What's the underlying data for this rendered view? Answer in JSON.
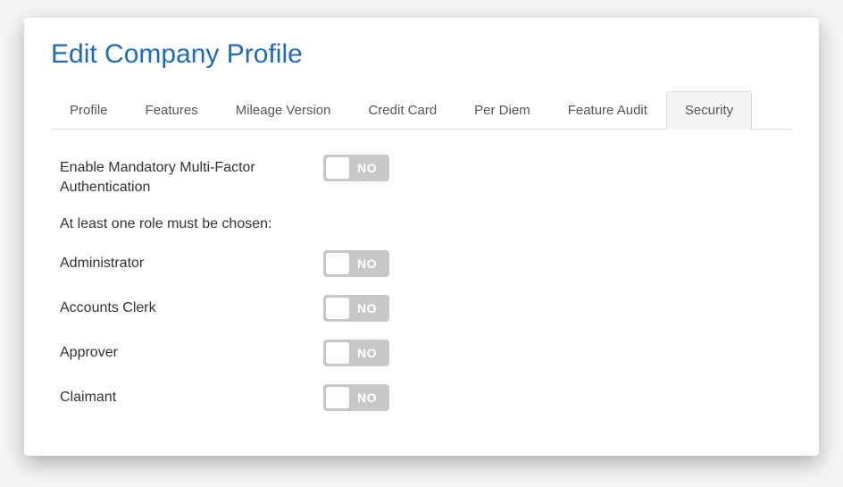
{
  "page_title": "Edit Company Profile",
  "tabs": [
    {
      "label": "Profile",
      "active": false
    },
    {
      "label": "Features",
      "active": false
    },
    {
      "label": "Mileage Version",
      "active": false
    },
    {
      "label": "Credit Card",
      "active": false
    },
    {
      "label": "Per Diem",
      "active": false
    },
    {
      "label": "Feature Audit",
      "active": false
    },
    {
      "label": "Security",
      "active": true
    }
  ],
  "mfa": {
    "label": "Enable Mandatory Multi-Factor Authentication",
    "toggle_text": "NO"
  },
  "roles_note": "At least one role must be chosen:",
  "roles": [
    {
      "label": "Administrator",
      "toggle_text": "NO"
    },
    {
      "label": "Accounts Clerk",
      "toggle_text": "NO"
    },
    {
      "label": "Approver",
      "toggle_text": "NO"
    },
    {
      "label": "Claimant",
      "toggle_text": "NO"
    }
  ]
}
